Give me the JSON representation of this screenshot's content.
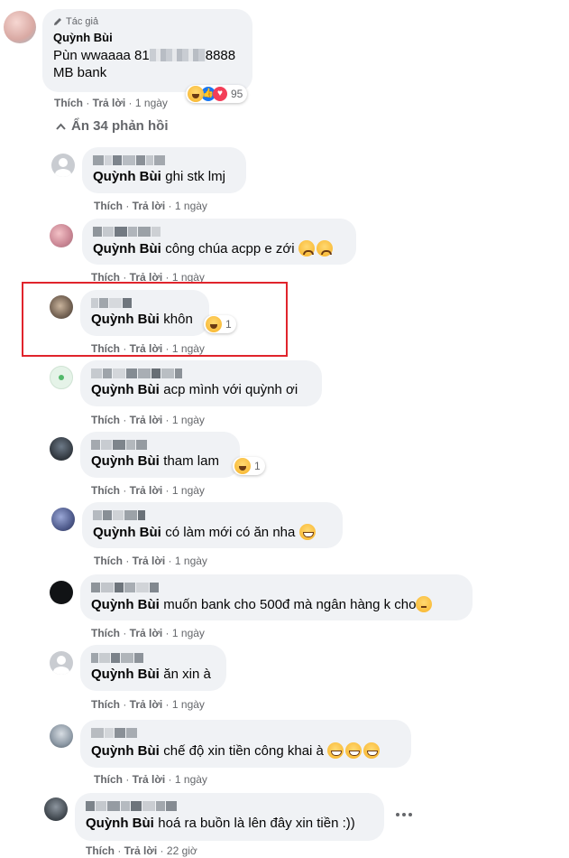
{
  "top": {
    "author_badge": "Tác giả",
    "name": "Quỳnh Bùi",
    "line1_start": "Pùn wwaaaa 81",
    "line1_end": "8888",
    "line2": "MB bank",
    "like": "Thích",
    "reply": "Trả lời",
    "time": "1 ngày",
    "reaction_count": "95"
  },
  "hide_replies": "Ẩn 34 phản hồi",
  "replies": [
    {
      "mention": "Quỳnh Bùi",
      "text": "ghi stk lmj",
      "like": "Thích",
      "reply": "Trả lời",
      "time": "1 ngày"
    },
    {
      "mention": "Quỳnh Bùi",
      "text": "công chúa acpp e zới",
      "like": "Thích",
      "reply": "Trả lời",
      "time": "1 ngày"
    },
    {
      "mention": "Quỳnh Bùi",
      "text": "khôn",
      "like": "Thích",
      "reply": "Trả lời",
      "time": "1 ngày",
      "reaction_count": "1"
    },
    {
      "mention": "Quỳnh Bùi",
      "text": "acp mình với quỳnh ơi",
      "like": "Thích",
      "reply": "Trả lời",
      "time": "1 ngày"
    },
    {
      "mention": "Quỳnh Bùi",
      "text": "tham lam",
      "like": "Thích",
      "reply": "Trả lời",
      "time": "1 ngày",
      "reaction_count": "1"
    },
    {
      "mention": "Quỳnh Bùi",
      "text": "có làm mới có ăn nha",
      "like": "Thích",
      "reply": "Trả lời",
      "time": "1 ngày"
    },
    {
      "mention": "Quỳnh Bùi",
      "text": "muốn bank cho 500đ mà ngân hàng k cho",
      "like": "Thích",
      "reply": "Trả lời",
      "time": "1 ngày"
    },
    {
      "mention": "Quỳnh Bùi",
      "text": "ăn xin à",
      "like": "Thích",
      "reply": "Trả lời",
      "time": "1 ngày"
    },
    {
      "mention": "Quỳnh Bùi",
      "text": "chế độ xin tiền công khai à",
      "like": "Thích",
      "reply": "Trả lời",
      "time": "1 ngày"
    },
    {
      "mention": "Quỳnh Bùi",
      "text": "hoá ra buồn là lên đây xin tiền :))",
      "like": "Thích",
      "reply": "Trả lời",
      "time": "22 giờ"
    }
  ],
  "colors": {
    "bubble": "#f0f2f5",
    "meta": "#65676b",
    "highlight_box": "#e0242c",
    "like_blue": "#1877f2",
    "love_red": "#f33e58"
  }
}
